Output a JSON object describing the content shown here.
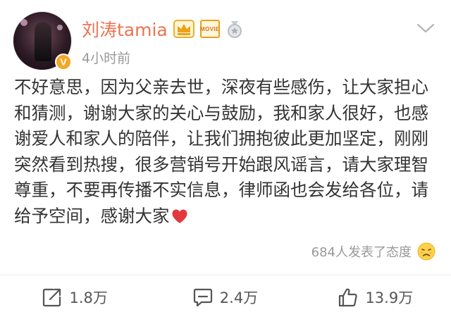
{
  "post": {
    "author": {
      "name": "刘涛tamia",
      "badges": [
        "crown-icon",
        "movie-badge",
        "medal-icon"
      ],
      "movie_badge_text": "MOVIE",
      "verified_badge_text": "V",
      "verified_color": "#f5a623"
    },
    "time": "4小时前",
    "text": "不好意思，因为父亲去世，深夜有些感伤，让大家担心和猜测，谢谢大家的关心与鼓励，我和家人很好，也感谢爱人和家人的陪伴，让我们拥抱彼此更加坚定，刚刚突然看到热搜，很多营销号开始跟风谣言，请大家理智尊重，不要再传播不实信息，律师函也会发给各位，请给予空间，感谢大家",
    "trailing_emoji": "heart-icon",
    "reactions_text": "684人发表了态度",
    "reaction_emoji": "sad-face-icon"
  },
  "actions": {
    "repost": {
      "icon": "repost-icon",
      "count": "1.8万"
    },
    "comment": {
      "icon": "comment-icon",
      "count": "2.4万"
    },
    "like": {
      "icon": "thumbs-up-icon",
      "count": "13.9万"
    }
  },
  "colors": {
    "username": "#eb7350",
    "meta": "#999999",
    "body_text": "#333333",
    "heart": "#e0393e"
  }
}
